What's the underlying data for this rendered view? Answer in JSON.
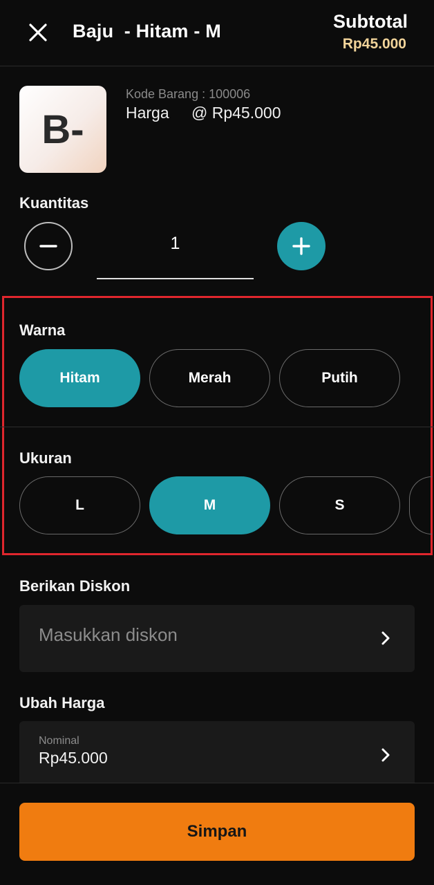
{
  "header": {
    "title": "Baju  - Hitam - M",
    "subtotal_label": "Subtotal",
    "subtotal_value": "Rp45.000",
    "close_icon": "close-icon"
  },
  "product": {
    "thumbnail_text": "B-",
    "kode_barang": "Kode Barang : 100006",
    "harga_label": "Harga",
    "harga_value": "@ Rp45.000"
  },
  "quantity": {
    "label": "Kuantitas",
    "value": "1",
    "minus_icon": "minus-icon",
    "plus_icon": "plus-icon"
  },
  "variants": {
    "warna": {
      "label": "Warna",
      "options": [
        "Hitam",
        "Merah",
        "Putih"
      ],
      "selected": "Hitam"
    },
    "ukuran": {
      "label": "Ukuran",
      "options": [
        "L",
        "M",
        "S"
      ],
      "selected": "M"
    }
  },
  "discount": {
    "label": "Berikan Diskon",
    "placeholder": "Masukkan diskon",
    "chevron_icon": "chevron-right-icon"
  },
  "price_change": {
    "label": "Ubah Harga",
    "field_label": "Nominal",
    "value": "Rp45.000",
    "chevron_icon": "chevron-right-icon"
  },
  "footer": {
    "save_label": "Simpan"
  },
  "colors": {
    "accent": "#1e9aa6",
    "primary_button": "#f07c10",
    "subtotal": "#f2d49a",
    "highlight": "#e0262d"
  }
}
